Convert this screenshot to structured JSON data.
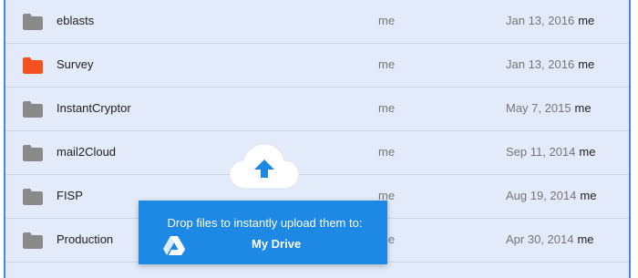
{
  "files": [
    {
      "name": "eblasts",
      "owner": "me",
      "date": "Jan 13, 2016",
      "modified_by": "me",
      "folder_color": "#8a8a8a"
    },
    {
      "name": "Survey",
      "owner": "me",
      "date": "Jan 13, 2016",
      "modified_by": "me",
      "folder_color": "#f4511e"
    },
    {
      "name": "InstantCryptor",
      "owner": "me",
      "date": "May 7, 2015",
      "modified_by": "me",
      "folder_color": "#8a8a8a"
    },
    {
      "name": "mail2Cloud",
      "owner": "me",
      "date": "Sep 11, 2014",
      "modified_by": "me",
      "folder_color": "#8a8a8a"
    },
    {
      "name": "FISP",
      "owner": "me",
      "date": "Aug 19, 2014",
      "modified_by": "me",
      "folder_color": "#8a8a8a"
    },
    {
      "name": "Production",
      "owner": "me",
      "date": "Apr 30, 2014",
      "modified_by": "me",
      "folder_color": "#8a8a8a"
    }
  ],
  "upload_toast": {
    "message": "Drop files to instantly upload them to:",
    "destination": "My Drive",
    "icons": [
      "cloud-upload-icon",
      "google-drive-icon"
    ],
    "color": "#1e88e5"
  }
}
